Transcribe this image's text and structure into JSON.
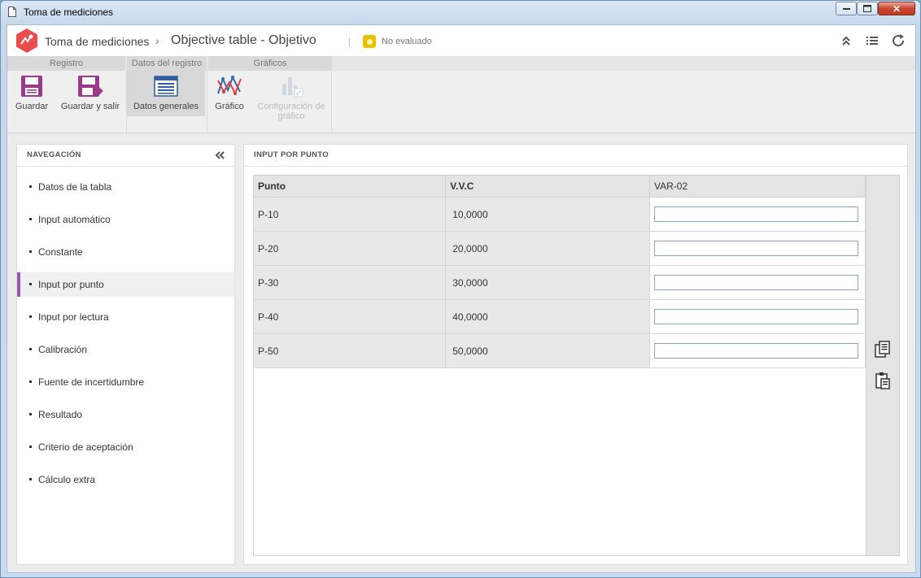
{
  "window": {
    "title": "Toma de mediciones",
    "controls": {
      "minimize": "minimize-icon",
      "maximize": "maximize-icon",
      "close": "✕"
    }
  },
  "header": {
    "module": "Toma de mediciones",
    "separator": "›",
    "title": "Objective table - Objetivo",
    "status": "No evaluado",
    "status_color": "#e8c200",
    "icons": [
      "collapse-up-icon",
      "list-icon",
      "refresh-icon"
    ]
  },
  "ribbon": {
    "tabs": [
      "Registro",
      "Datos del registro",
      "Gráficos"
    ],
    "buttons": {
      "save": "Guardar",
      "save_exit": "Guardar y salir",
      "general": "Datos generales",
      "chart": "Gráfico",
      "chart_config": "Configuración de gráfico"
    },
    "accent": "#9b3a8a"
  },
  "nav": {
    "title": "NAVEGACIÓN",
    "items": [
      "Datos de la tabla",
      "Input automático",
      "Constante",
      "Input por punto",
      "Input por lectura",
      "Calibración",
      "Fuente de incertidumbre",
      "Resultado",
      "Criterio de aceptación",
      "Cálculo extra"
    ],
    "active_index": 3,
    "active_color": "#9b59b6"
  },
  "main": {
    "title": "INPUT POR PUNTO",
    "columns": [
      "Punto",
      "V.V.C",
      "VAR-02"
    ],
    "rows": [
      {
        "punto": "P-10",
        "vvc": "10,0000",
        "var": ""
      },
      {
        "punto": "P-20",
        "vvc": "20,0000",
        "var": ""
      },
      {
        "punto": "P-30",
        "vvc": "30,0000",
        "var": ""
      },
      {
        "punto": "P-40",
        "vvc": "40,0000",
        "var": ""
      },
      {
        "punto": "P-50",
        "vvc": "50,0000",
        "var": ""
      }
    ],
    "tools": [
      "copy-icon",
      "paste-icon"
    ]
  }
}
